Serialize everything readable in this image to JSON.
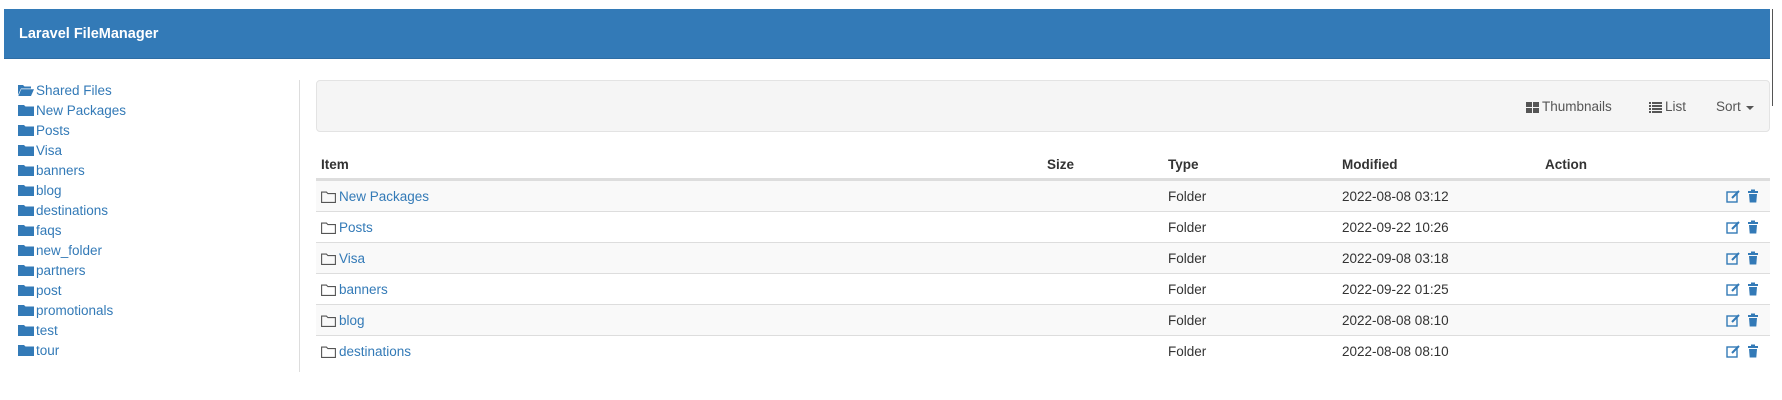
{
  "app": {
    "title": "Laravel FileManager"
  },
  "colors": {
    "navbar": "#337ab7",
    "link": "#337ab7",
    "stripe": "#f9f9f9"
  },
  "sidebar": {
    "root": {
      "label": "Shared Files",
      "icon": "folder-open-icon"
    },
    "items": [
      {
        "label": "New Packages",
        "icon": "folder-icon"
      },
      {
        "label": "Posts",
        "icon": "folder-icon"
      },
      {
        "label": "Visa",
        "icon": "folder-icon"
      },
      {
        "label": "banners",
        "icon": "folder-icon"
      },
      {
        "label": "blog",
        "icon": "folder-icon"
      },
      {
        "label": "destinations",
        "icon": "folder-icon"
      },
      {
        "label": "faqs",
        "icon": "folder-icon"
      },
      {
        "label": "new_folder",
        "icon": "folder-icon"
      },
      {
        "label": "partners",
        "icon": "folder-icon"
      },
      {
        "label": "post",
        "icon": "folder-icon"
      },
      {
        "label": "promotionals",
        "icon": "folder-icon"
      },
      {
        "label": "test",
        "icon": "folder-icon"
      },
      {
        "label": "tour",
        "icon": "folder-icon"
      }
    ]
  },
  "toolbar": {
    "thumbnails_label": "Thumbnails",
    "list_label": "List",
    "sort_label": "Sort"
  },
  "table": {
    "headers": {
      "item": "Item",
      "size": "Size",
      "type": "Type",
      "modified": "Modified",
      "action": "Action"
    },
    "rows": [
      {
        "name": "New Packages",
        "size": "",
        "type": "Folder",
        "modified": "2022-08-08 03:12"
      },
      {
        "name": "Posts",
        "size": "",
        "type": "Folder",
        "modified": "2022-09-22 10:26"
      },
      {
        "name": "Visa",
        "size": "",
        "type": "Folder",
        "modified": "2022-09-08 03:18"
      },
      {
        "name": "banners",
        "size": "",
        "type": "Folder",
        "modified": "2022-09-22 01:25"
      },
      {
        "name": "blog",
        "size": "",
        "type": "Folder",
        "modified": "2022-08-08 08:10"
      },
      {
        "name": "destinations",
        "size": "",
        "type": "Folder",
        "modified": "2022-08-08 08:10"
      }
    ]
  }
}
